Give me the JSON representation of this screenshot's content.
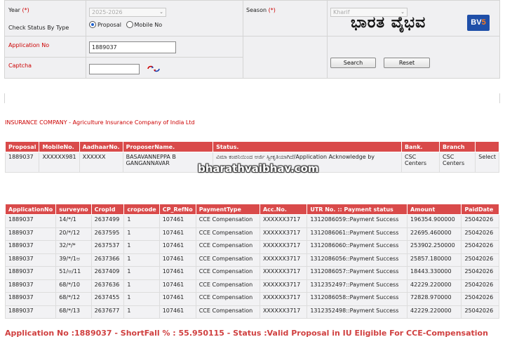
{
  "form": {
    "year_label": "Year",
    "year_req": "(*)",
    "year_value": "2025-2026",
    "season_label": "Season",
    "season_req": "(*)",
    "season_value": "Kharif",
    "check_status_label": "Check Status By Type",
    "radio_proposal": "Proposal",
    "radio_mobile": "Mobile No",
    "application_no_label": "Application No",
    "application_no_value": "1889037",
    "captcha_label": "Captcha",
    "captcha_value": "",
    "refresh_icon": "refresh-captcha-icon",
    "search_button": "Search",
    "reset_button": "Reset"
  },
  "logo": {
    "text": "ಭಾರತ ವೈಭವ",
    "badge_bv": "BV",
    "badge_five": "5"
  },
  "insurance_company": "INSURANCE COMPANY - Agriculture Insurance Company of India Ltd",
  "proposal_table": {
    "headers": [
      "Proposal",
      "MobileNo.",
      "AadhaarNo.",
      "ProposerName.",
      "Status.",
      "Bank.",
      "Branch",
      ""
    ],
    "row": [
      "1889037",
      "XXXXXX981",
      "XXXXXX",
      "BASAVANNEPPA B GANGANNAVAR",
      "ವಿಮಾ ಕಂಪನಿಯಿಂದ ಅರ್ಜಿ ಸ್ವೀಕೃತಿಯಾಗಿದೆ/Application Acknowledge by",
      "CSC Centers",
      "CSC Centers",
      "Select"
    ]
  },
  "watermark": "bharathvaibhav.com",
  "payment_table": {
    "headers": [
      "ApplicationNo",
      "surveyno",
      "CropId",
      "cropcode",
      "CP_RefNo",
      "PaymentType",
      "Acc.No.",
      "UTR No. :: Payment status",
      "Amount",
      "PaidDate"
    ],
    "rows": [
      [
        "1889037",
        "14/*/1",
        "2637499",
        "1",
        "107461",
        "CCE Compensation",
        "XXXXXX3717",
        "1312086059::Payment Success",
        "196354.900000",
        "25042026"
      ],
      [
        "1889037",
        "20/*/12",
        "2637595",
        "1",
        "107461",
        "CCE Compensation",
        "XXXXXX3717",
        "1312086061::Payment Success",
        "22695.460000",
        "25042026"
      ],
      [
        "1889037",
        "32/*/*",
        "2637537",
        "1",
        "107461",
        "CCE Compensation",
        "XXXXXX3717",
        "1312086060::Payment Success",
        "253902.250000",
        "25042026"
      ],
      [
        "1889037",
        "39/*/1ಅ",
        "2637366",
        "1",
        "107461",
        "CCE Compensation",
        "XXXXXX3717",
        "1312086056::Payment Success",
        "25857.180000",
        "25042026"
      ],
      [
        "1889037",
        "51/ಅ/11",
        "2637409",
        "1",
        "107461",
        "CCE Compensation",
        "XXXXXX3717",
        "1312086057::Payment Success",
        "18443.330000",
        "25042026"
      ],
      [
        "1889037",
        "68/*/10",
        "2637636",
        "1",
        "107461",
        "CCE Compensation",
        "XXXXXX3717",
        "1312352497::Payment Success",
        "42229.220000",
        "25042026"
      ],
      [
        "1889037",
        "68/*/12",
        "2637455",
        "1",
        "107461",
        "CCE Compensation",
        "XXXXXX3717",
        "1312086058::Payment Success",
        "72828.970000",
        "25042026"
      ],
      [
        "1889037",
        "68/*/13",
        "2637677",
        "1",
        "107461",
        "CCE Compensation",
        "XXXXXX3717",
        "1312352498::Payment Success",
        "42229.220000",
        "25042026"
      ]
    ]
  },
  "status_line": "Application No :1889037 - ShortFall % : 55.950115 - Status :Valid Proposal in IU Eligible For CCE-Compensation"
}
